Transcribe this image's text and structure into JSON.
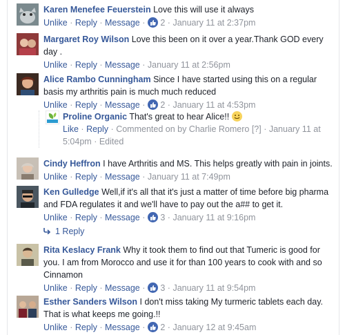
{
  "comments": [
    {
      "name": "Karen Menefee Feuerstein",
      "text": "Love this will use it always",
      "actions": {
        "unlike": "Unlike",
        "reply": "Reply",
        "message": "Message",
        "likes": "2",
        "time": "January 11 at 2:37pm"
      }
    },
    {
      "name": "Margaret Roy Wilson",
      "text": "Love this been on it over a year.Thank GOD every day .",
      "actions": {
        "unlike": "Unlike",
        "reply": "Reply",
        "message": "Message",
        "likes": "",
        "time": "January 11 at 2:56pm"
      }
    },
    {
      "name": "Alice Rambo Cunningham",
      "text": "Since I have started using this on a regular basis my arthritis pain is much much reduced",
      "actions": {
        "unlike": "Unlike",
        "reply": "Reply",
        "message": "Message",
        "likes": "2",
        "time": "January 11 at 4:53pm"
      }
    },
    {
      "name": "Cindy Heffron",
      "text": "I have Arthritis and MS. This helps greatly with pain in joints.",
      "actions": {
        "unlike": "Unlike",
        "reply": "Reply",
        "message": "Message",
        "likes": "",
        "time": "January 11 at 7:49pm"
      }
    },
    {
      "name": "Ken Gulledge",
      "text": "Well,if it's all that it's just a matter of time before big pharma and FDA regulates it and we'll have to pay out the a## to get it.",
      "actions": {
        "unlike": "Unlike",
        "reply": "Reply",
        "message": "Message",
        "likes": "3",
        "time": "January 11 at 9:16pm"
      }
    },
    {
      "name": "Rita Keslacy Frank",
      "text": "Why it took them to find out that Tumeric is good for you. I am from Morocco and use it for than 100 years to cook with and so Cinnamon",
      "actions": {
        "unlike": "Unlike",
        "reply": "Reply",
        "message": "Message",
        "likes": "3",
        "time": "January 11 at 9:54pm"
      }
    },
    {
      "name": "Esther Sanders Wilson",
      "text": "I don't miss taking My turmeric tablets each day. That is what keeps me going.!!",
      "actions": {
        "unlike": "Unlike",
        "reply": "Reply",
        "message": "Message",
        "likes": "2",
        "time": "January 12 at 9:45am"
      }
    }
  ],
  "reply": {
    "name": "Proline Organic",
    "text": "That's great to hear Alice!!",
    "emoji": "smile-emoji",
    "like": "Like",
    "reply": "Reply",
    "commented_on": "Commented on by Charlie Romero",
    "help": "[?]",
    "time": "January 11 at 5:04pm",
    "edited": "Edited"
  },
  "replies_link": "1 Reply",
  "colors": {
    "link": "#365899",
    "meta": "#90949c",
    "like_badge": "#4267b2",
    "text": "#1d2129"
  }
}
